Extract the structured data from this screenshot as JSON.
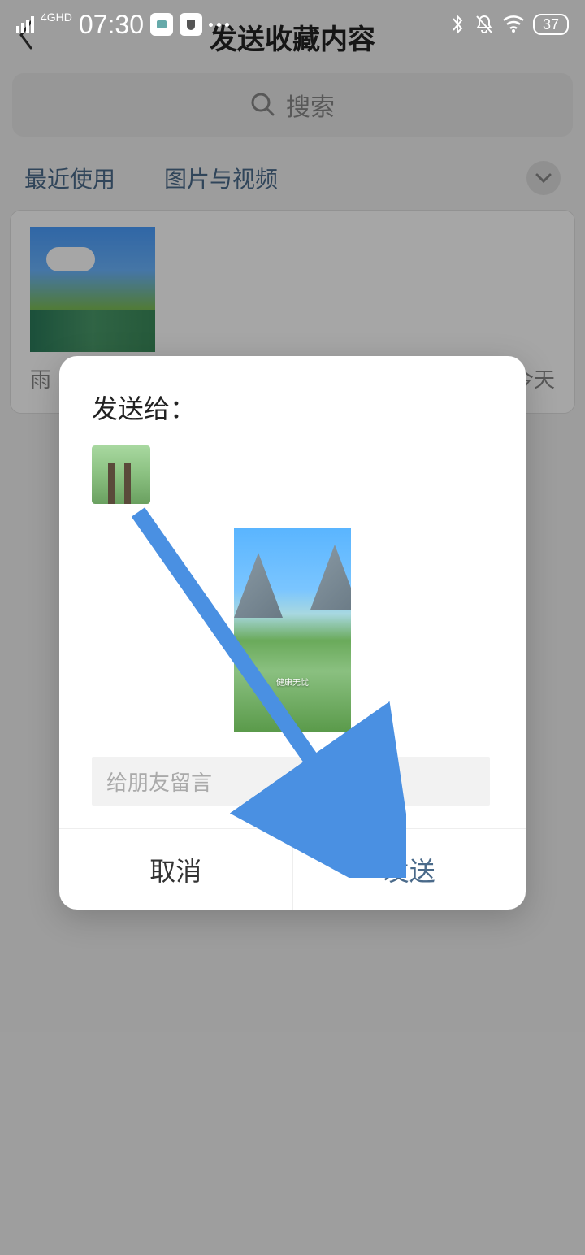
{
  "status_bar": {
    "network_label": "4GHD",
    "time": "07:30",
    "battery": "37"
  },
  "header": {
    "title": "发送收藏内容"
  },
  "search": {
    "placeholder": "搜索"
  },
  "tabs": {
    "recent": "最近使用",
    "media": "图片与视频"
  },
  "content": {
    "item_label": "雨",
    "item_date": "今天"
  },
  "modal": {
    "title": "发送给：",
    "message_placeholder": "给朋友留言",
    "cancel": "取消",
    "send": "发送"
  }
}
